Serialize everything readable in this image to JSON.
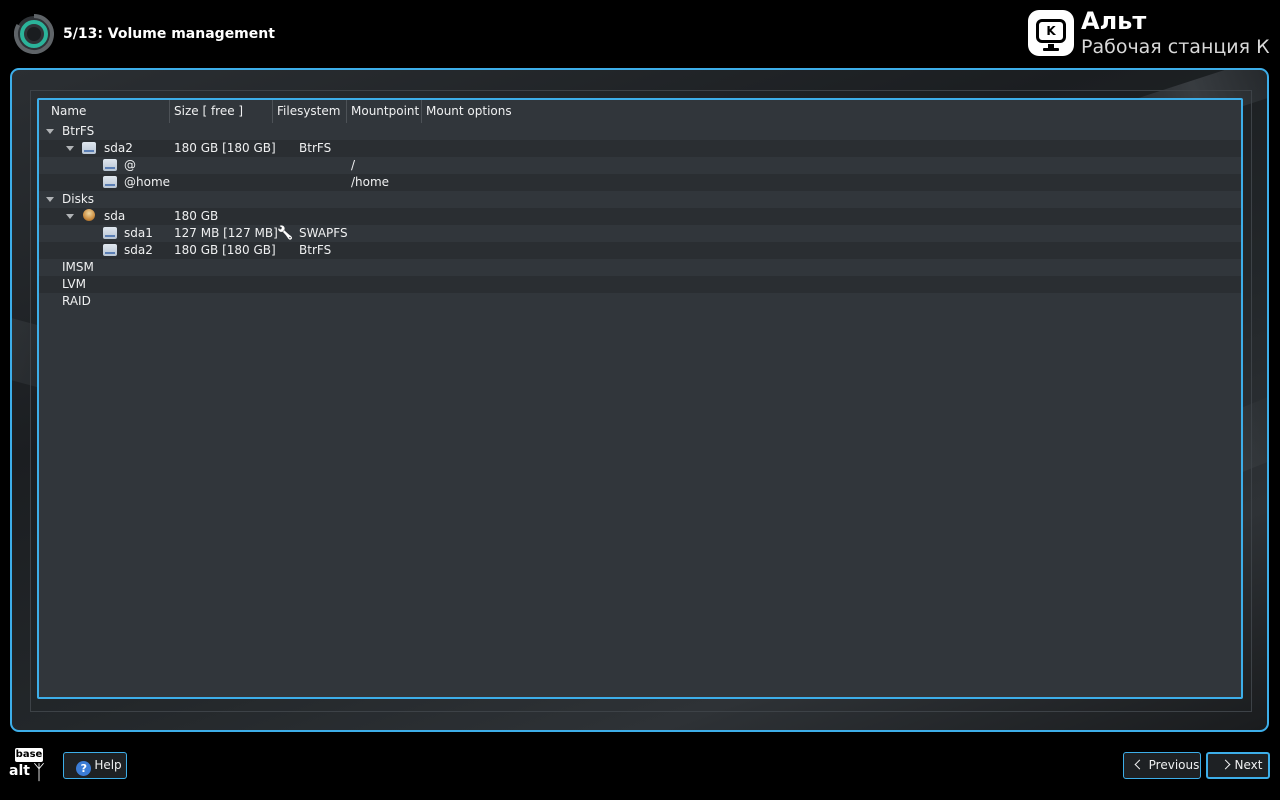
{
  "header": {
    "step_title": "5/13: Volume management",
    "brand_name": "Альт",
    "brand_subtitle": "Рабочая станция К",
    "brand_logo_letter": "K"
  },
  "tree": {
    "columns": [
      "Name",
      "Size [ free ]",
      "Filesystem",
      "Mountpoint",
      "Mount options"
    ],
    "rows": [
      {
        "level": 0,
        "expander": true,
        "icon": "",
        "name": "BtrFS",
        "size": "",
        "fs_icon": "",
        "filesystem": "",
        "mountpoint": ""
      },
      {
        "level": 1,
        "expander": true,
        "icon": "drive-icon",
        "name": "sda2",
        "size": "180 GB [180 GB]",
        "fs_icon": "",
        "filesystem": "BtrFS",
        "mountpoint": ""
      },
      {
        "level": 2,
        "expander": false,
        "icon": "drive-icon",
        "name": "@",
        "size": "",
        "fs_icon": "",
        "filesystem": "",
        "mountpoint": "/"
      },
      {
        "level": 2,
        "expander": false,
        "icon": "drive-icon",
        "name": "@home",
        "size": "",
        "fs_icon": "",
        "filesystem": "",
        "mountpoint": "/home"
      },
      {
        "level": 0,
        "expander": true,
        "icon": "",
        "name": "Disks",
        "size": "",
        "fs_icon": "",
        "filesystem": "",
        "mountpoint": ""
      },
      {
        "level": 1,
        "expander": true,
        "icon": "hdd-icon",
        "name": "sda",
        "size": "180 GB",
        "fs_icon": "",
        "filesystem": "",
        "mountpoint": ""
      },
      {
        "level": 2,
        "expander": false,
        "icon": "drive-icon",
        "name": "sda1",
        "size": "127 MB [127 MB]",
        "fs_icon": "wrench-icon",
        "filesystem": "SWAPFS",
        "mountpoint": ""
      },
      {
        "level": 2,
        "expander": false,
        "icon": "drive-icon",
        "name": "sda2",
        "size": "180 GB [180 GB]",
        "fs_icon": "",
        "filesystem": "BtrFS",
        "mountpoint": ""
      },
      {
        "level": 0,
        "expander": false,
        "icon": "",
        "name": "IMSM",
        "size": "",
        "fs_icon": "",
        "filesystem": "",
        "mountpoint": ""
      },
      {
        "level": 0,
        "expander": false,
        "icon": "",
        "name": "LVM",
        "size": "",
        "fs_icon": "",
        "filesystem": "",
        "mountpoint": ""
      },
      {
        "level": 0,
        "expander": false,
        "icon": "",
        "name": "RAID",
        "size": "",
        "fs_icon": "",
        "filesystem": "",
        "mountpoint": ""
      }
    ]
  },
  "footer": {
    "vendor_logo_top": "base",
    "vendor_logo_bottom": "alt",
    "help_label": "Help",
    "previous_label": "Previous",
    "next_label": "Next"
  },
  "colors": {
    "accent": "#3daee9",
    "background": "#000000",
    "panel": "#31363b",
    "alt_row": "#2a2e32"
  }
}
